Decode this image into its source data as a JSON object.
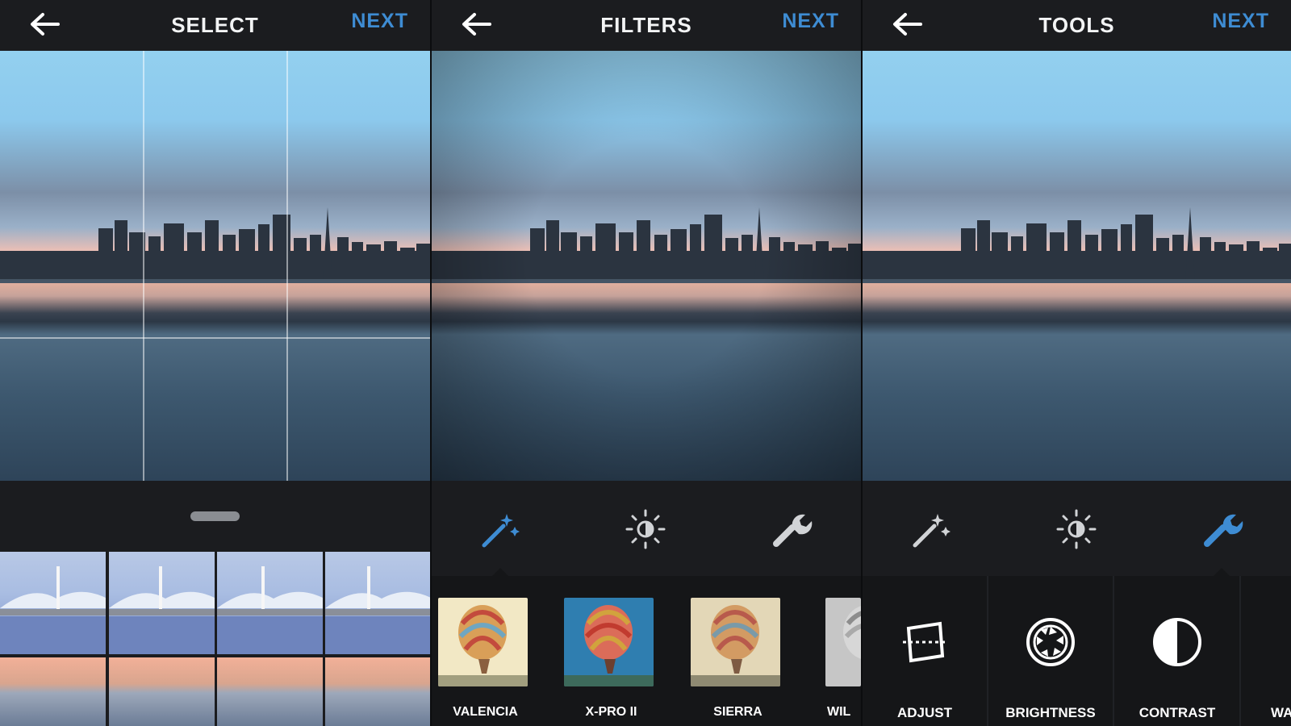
{
  "colors": {
    "accent": "#3e8cd3",
    "panel_background": "#1b1c1f",
    "strip_background": "#151618"
  },
  "select_panel": {
    "title": "SELECT",
    "next_label": "NEXT"
  },
  "filters_panel": {
    "title": "FILTERS",
    "next_label": "NEXT",
    "filters": [
      {
        "label": "VALENCIA"
      },
      {
        "label": "X-PRO II"
      },
      {
        "label": "SIERRA"
      },
      {
        "label": "WIL"
      }
    ]
  },
  "tools_panel": {
    "title": "TOOLS",
    "next_label": "NEXT",
    "tools": [
      {
        "label": "ADJUST"
      },
      {
        "label": "BRIGHTNESS"
      },
      {
        "label": "CONTRAST"
      },
      {
        "label": "WA"
      }
    ]
  },
  "icons": {
    "back": "arrow-left",
    "magic_wand": "magic-wand",
    "brightness": "sun",
    "tools": "wrench",
    "adjust": "square-with-dashed-line",
    "brightness_tool": "aperture",
    "contrast_tool": "half-circle"
  }
}
